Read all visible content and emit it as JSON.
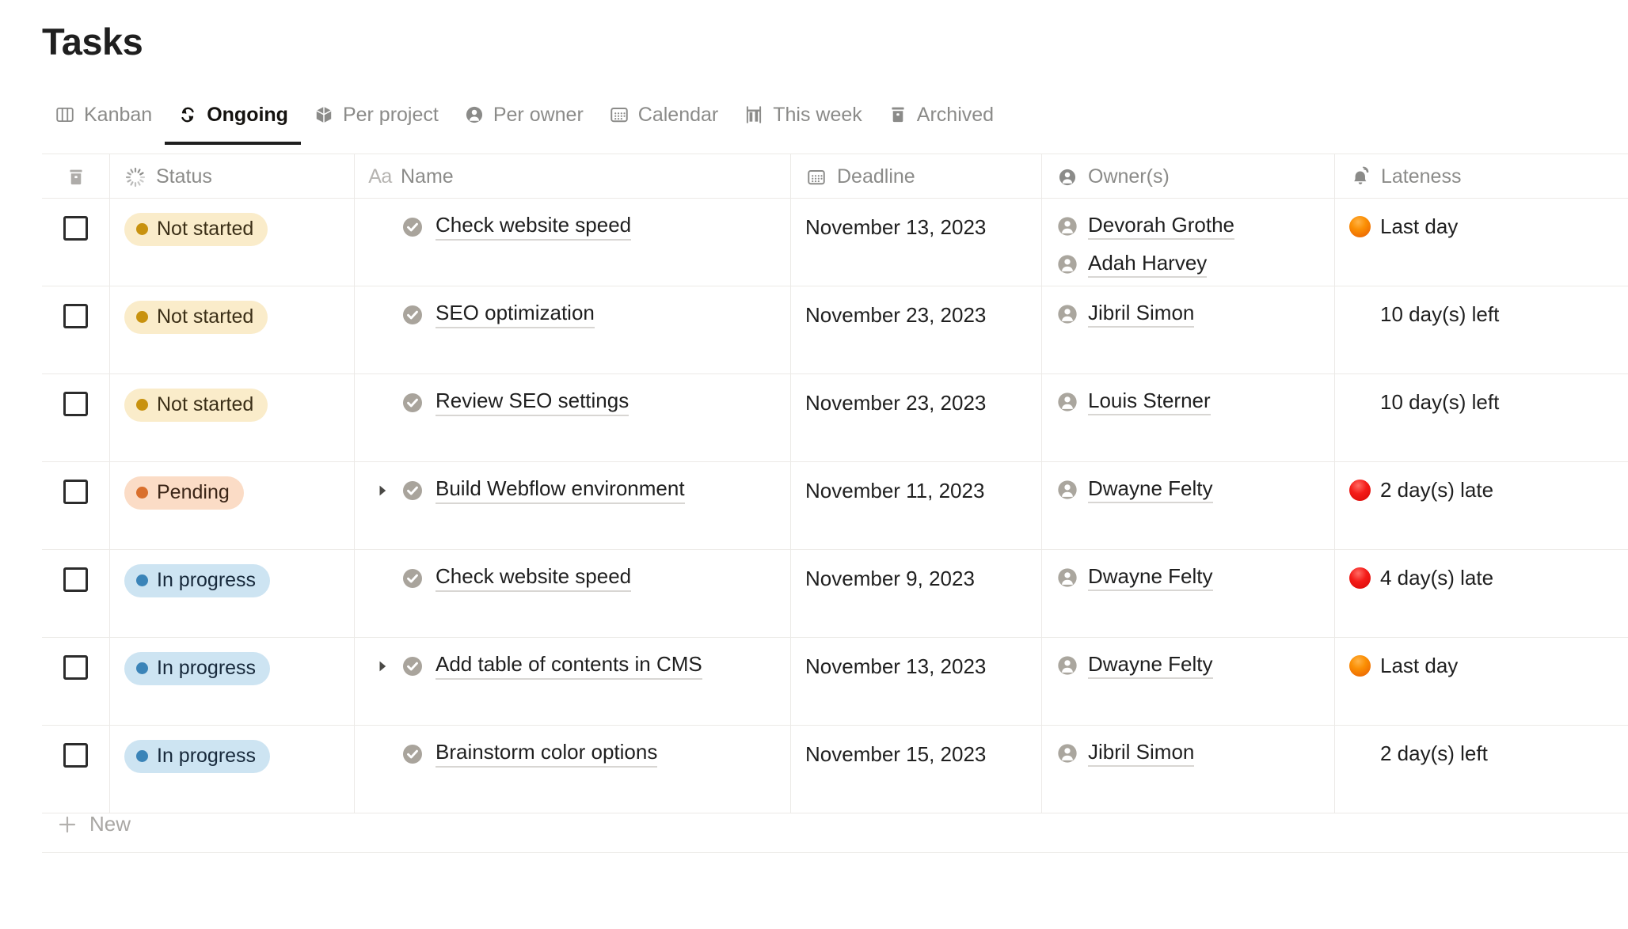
{
  "header": {
    "title": "Tasks"
  },
  "tabs": [
    {
      "label": "Kanban",
      "icon": "kanban-board-icon",
      "active": false
    },
    {
      "label": "Ongoing",
      "icon": "refresh-cycle-icon",
      "active": true
    },
    {
      "label": "Per project",
      "icon": "cube-icon",
      "active": false
    },
    {
      "label": "Per owner",
      "icon": "person-circle-icon",
      "active": false
    },
    {
      "label": "Calendar",
      "icon": "calendar-icon",
      "active": false
    },
    {
      "label": "This week",
      "icon": "bar-chart-icon",
      "active": false
    },
    {
      "label": "Archived",
      "icon": "archive-box-icon",
      "active": false
    }
  ],
  "table": {
    "columns": [
      {
        "key": "check",
        "label": "",
        "icon": "archive-box-icon"
      },
      {
        "key": "status",
        "label": "Status",
        "icon": "loading-spinner-icon"
      },
      {
        "key": "name",
        "label": "Name",
        "icon": "text-aa-icon"
      },
      {
        "key": "deadline",
        "label": "Deadline",
        "icon": "calendar-icon"
      },
      {
        "key": "owner",
        "label": "Owner(s)",
        "icon": "person-circle-icon"
      },
      {
        "key": "lateness",
        "label": "Lateness",
        "icon": "bell-alert-icon"
      }
    ],
    "rows": [
      {
        "checked": false,
        "status": {
          "label": "Not started",
          "variant": "st-notstarted"
        },
        "expandable": false,
        "name": "Check website speed",
        "deadline": "November 13, 2023",
        "owners": [
          "Devorah Grothe",
          "Adah Harvey"
        ],
        "lateness": {
          "text": "Last day",
          "color": "orange"
        }
      },
      {
        "checked": false,
        "status": {
          "label": "Not started",
          "variant": "st-notstarted"
        },
        "expandable": false,
        "name": "SEO optimization",
        "deadline": "November 23, 2023",
        "owners": [
          "Jibril Simon"
        ],
        "lateness": {
          "text": "10 day(s) left",
          "color": "yellow"
        }
      },
      {
        "checked": false,
        "status": {
          "label": "Not started",
          "variant": "st-notstarted"
        },
        "expandable": false,
        "name": "Review SEO settings",
        "deadline": "November 23, 2023",
        "owners": [
          "Louis Sterner"
        ],
        "lateness": {
          "text": "10 day(s) left",
          "color": "yellow"
        }
      },
      {
        "checked": false,
        "status": {
          "label": "Pending",
          "variant": "st-pending"
        },
        "expandable": true,
        "name": "Build Webflow environment",
        "deadline": "November 11, 2023",
        "owners": [
          "Dwayne Felty"
        ],
        "lateness": {
          "text": "2 day(s) late",
          "color": "red"
        }
      },
      {
        "checked": false,
        "status": {
          "label": "In progress",
          "variant": "st-inprogress"
        },
        "expandable": false,
        "name": "Check website speed",
        "deadline": "November 9, 2023",
        "owners": [
          "Dwayne Felty"
        ],
        "lateness": {
          "text": "4 day(s) late",
          "color": "red"
        }
      },
      {
        "checked": false,
        "status": {
          "label": "In progress",
          "variant": "st-inprogress"
        },
        "expandable": true,
        "name": "Add table of contents in CMS",
        "deadline": "November 13, 2023",
        "owners": [
          "Dwayne Felty"
        ],
        "lateness": {
          "text": "Last day",
          "color": "orange"
        }
      },
      {
        "checked": false,
        "status": {
          "label": "In progress",
          "variant": "st-inprogress"
        },
        "expandable": false,
        "name": "Brainstorm color options",
        "deadline": "November 15, 2023",
        "owners": [
          "Jibril Simon"
        ],
        "lateness": {
          "text": "2 day(s) left",
          "color": "yellow"
        }
      }
    ],
    "new_row_label": "New"
  },
  "colors": {
    "not_started_bg": "#faecca",
    "not_started_dot": "#c8920f",
    "pending_bg": "#fbdcc6",
    "pending_dot": "#d96f2c",
    "in_progress_bg": "#cde4f2",
    "in_progress_dot": "#3b84b8",
    "late_red": "#f41c19",
    "last_day_orange": "#fb9005",
    "days_left_yellow": "#fcd215",
    "active_tab_underline": "#1f1f1f"
  }
}
